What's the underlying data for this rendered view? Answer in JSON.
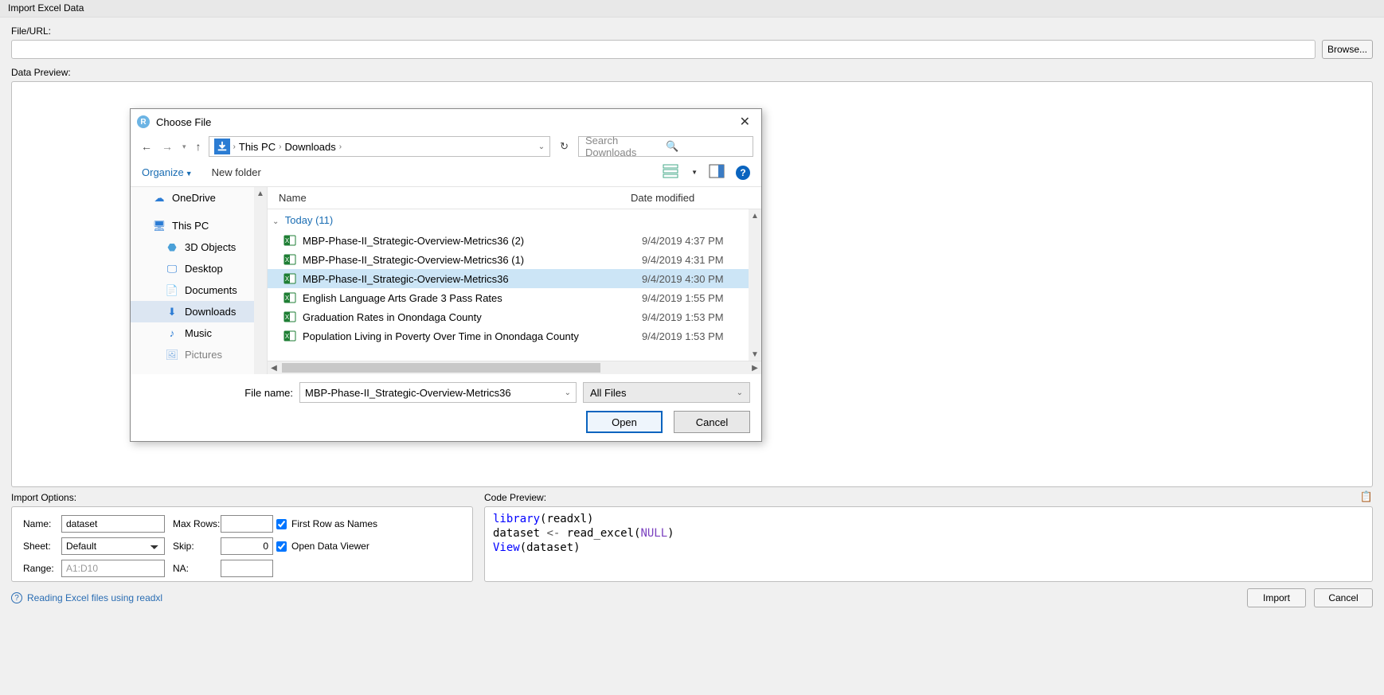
{
  "window": {
    "title": "Import Excel Data"
  },
  "labels": {
    "file_url": "File/URL:",
    "data_preview": "Data Preview:",
    "import_options": "Import Options:",
    "code_preview": "Code Preview:"
  },
  "buttons": {
    "browse": "Browse...",
    "import": "Import",
    "cancel": "Cancel"
  },
  "file_dialog": {
    "title": "Choose File",
    "breadcrumbs": [
      "This PC",
      "Downloads"
    ],
    "search_placeholder": "Search Downloads",
    "organize": "Organize",
    "new_folder": "New folder",
    "columns": {
      "name": "Name",
      "date": "Date modified"
    },
    "nav": [
      {
        "label": "OneDrive",
        "icon": "cloud"
      },
      {
        "label": "This PC",
        "icon": "pc"
      },
      {
        "label": "3D Objects",
        "icon": "3d",
        "sub": true
      },
      {
        "label": "Desktop",
        "icon": "desktop",
        "sub": true
      },
      {
        "label": "Documents",
        "icon": "doc",
        "sub": true
      },
      {
        "label": "Downloads",
        "icon": "download",
        "sub": true,
        "selected": true
      },
      {
        "label": "Music",
        "icon": "music",
        "sub": true
      },
      {
        "label": "Pictures",
        "icon": "pic",
        "sub": true
      }
    ],
    "group_header": "Today (11)",
    "files": [
      {
        "name": "MBP-Phase-II_Strategic-Overview-Metrics36 (2)",
        "date": "9/4/2019 4:37 PM"
      },
      {
        "name": "MBP-Phase-II_Strategic-Overview-Metrics36 (1)",
        "date": "9/4/2019 4:31 PM"
      },
      {
        "name": "MBP-Phase-II_Strategic-Overview-Metrics36",
        "date": "9/4/2019 4:30 PM",
        "selected": true
      },
      {
        "name": "English Language Arts Grade 3 Pass Rates",
        "date": "9/4/2019 1:55 PM"
      },
      {
        "name": "Graduation Rates in Onondaga County",
        "date": "9/4/2019 1:53 PM"
      },
      {
        "name": "Population Living in Poverty Over Time in Onondaga County",
        "date": "9/4/2019 1:53 PM"
      }
    ],
    "file_name_label": "File name:",
    "file_name_value": "MBP-Phase-II_Strategic-Overview-Metrics36",
    "file_type": "All Files",
    "open": "Open",
    "cancel": "Cancel"
  },
  "import_options": {
    "name_label": "Name:",
    "name_value": "dataset",
    "sheet_label": "Sheet:",
    "sheet_value": "Default",
    "range_label": "Range:",
    "range_placeholder": "A1:D10",
    "max_rows_label": "Max Rows:",
    "max_rows_value": "",
    "skip_label": "Skip:",
    "skip_value": "0",
    "na_label": "NA:",
    "na_value": "",
    "first_row": "First Row as Names",
    "open_viewer": "Open Data Viewer"
  },
  "code": {
    "l1a": "library",
    "l1b": "(readxl)",
    "l2a": "dataset ",
    "l2b": "<-",
    "l2c": " read_excel(",
    "l2d": "NULL",
    "l2e": ")",
    "l3a": "View",
    "l3b": "(dataset)"
  },
  "help_link": "Reading Excel files using readxl"
}
